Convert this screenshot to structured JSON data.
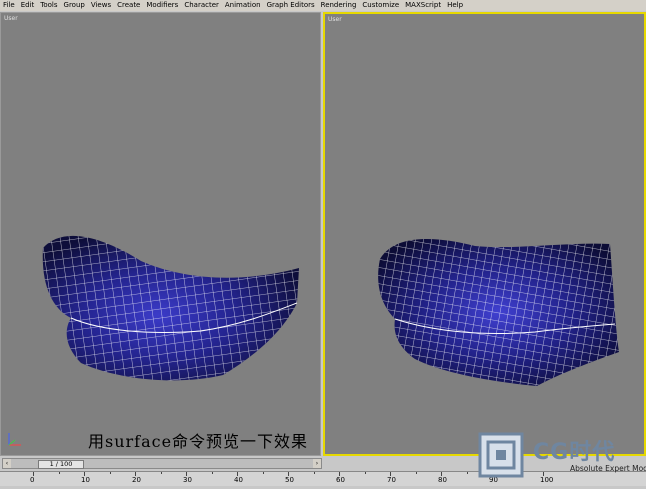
{
  "menu": [
    "File",
    "Edit",
    "Tools",
    "Group",
    "Views",
    "Create",
    "Modifiers",
    "Character",
    "Animation",
    "Graph Editors",
    "Rendering",
    "Customize",
    "MAXScript",
    "Help"
  ],
  "viewports": {
    "left": {
      "label": "User"
    },
    "right": {
      "label": "User"
    }
  },
  "caption": "用surface命令预览一下效果",
  "timeslider": {
    "frame": "1 / 100"
  },
  "ruler": {
    "labels": [
      "0",
      "10",
      "20",
      "30",
      "40",
      "50",
      "60",
      "70",
      "80",
      "90",
      "100"
    ]
  },
  "logo": {
    "text": "CG时代",
    "subtitle": "Absolute Expert Mode"
  },
  "colors": {
    "mesh_fill": "#2a2a9a",
    "mesh_wire": "#ffffff",
    "active_border": "#e6d800",
    "viewport_bg": "#808080"
  }
}
